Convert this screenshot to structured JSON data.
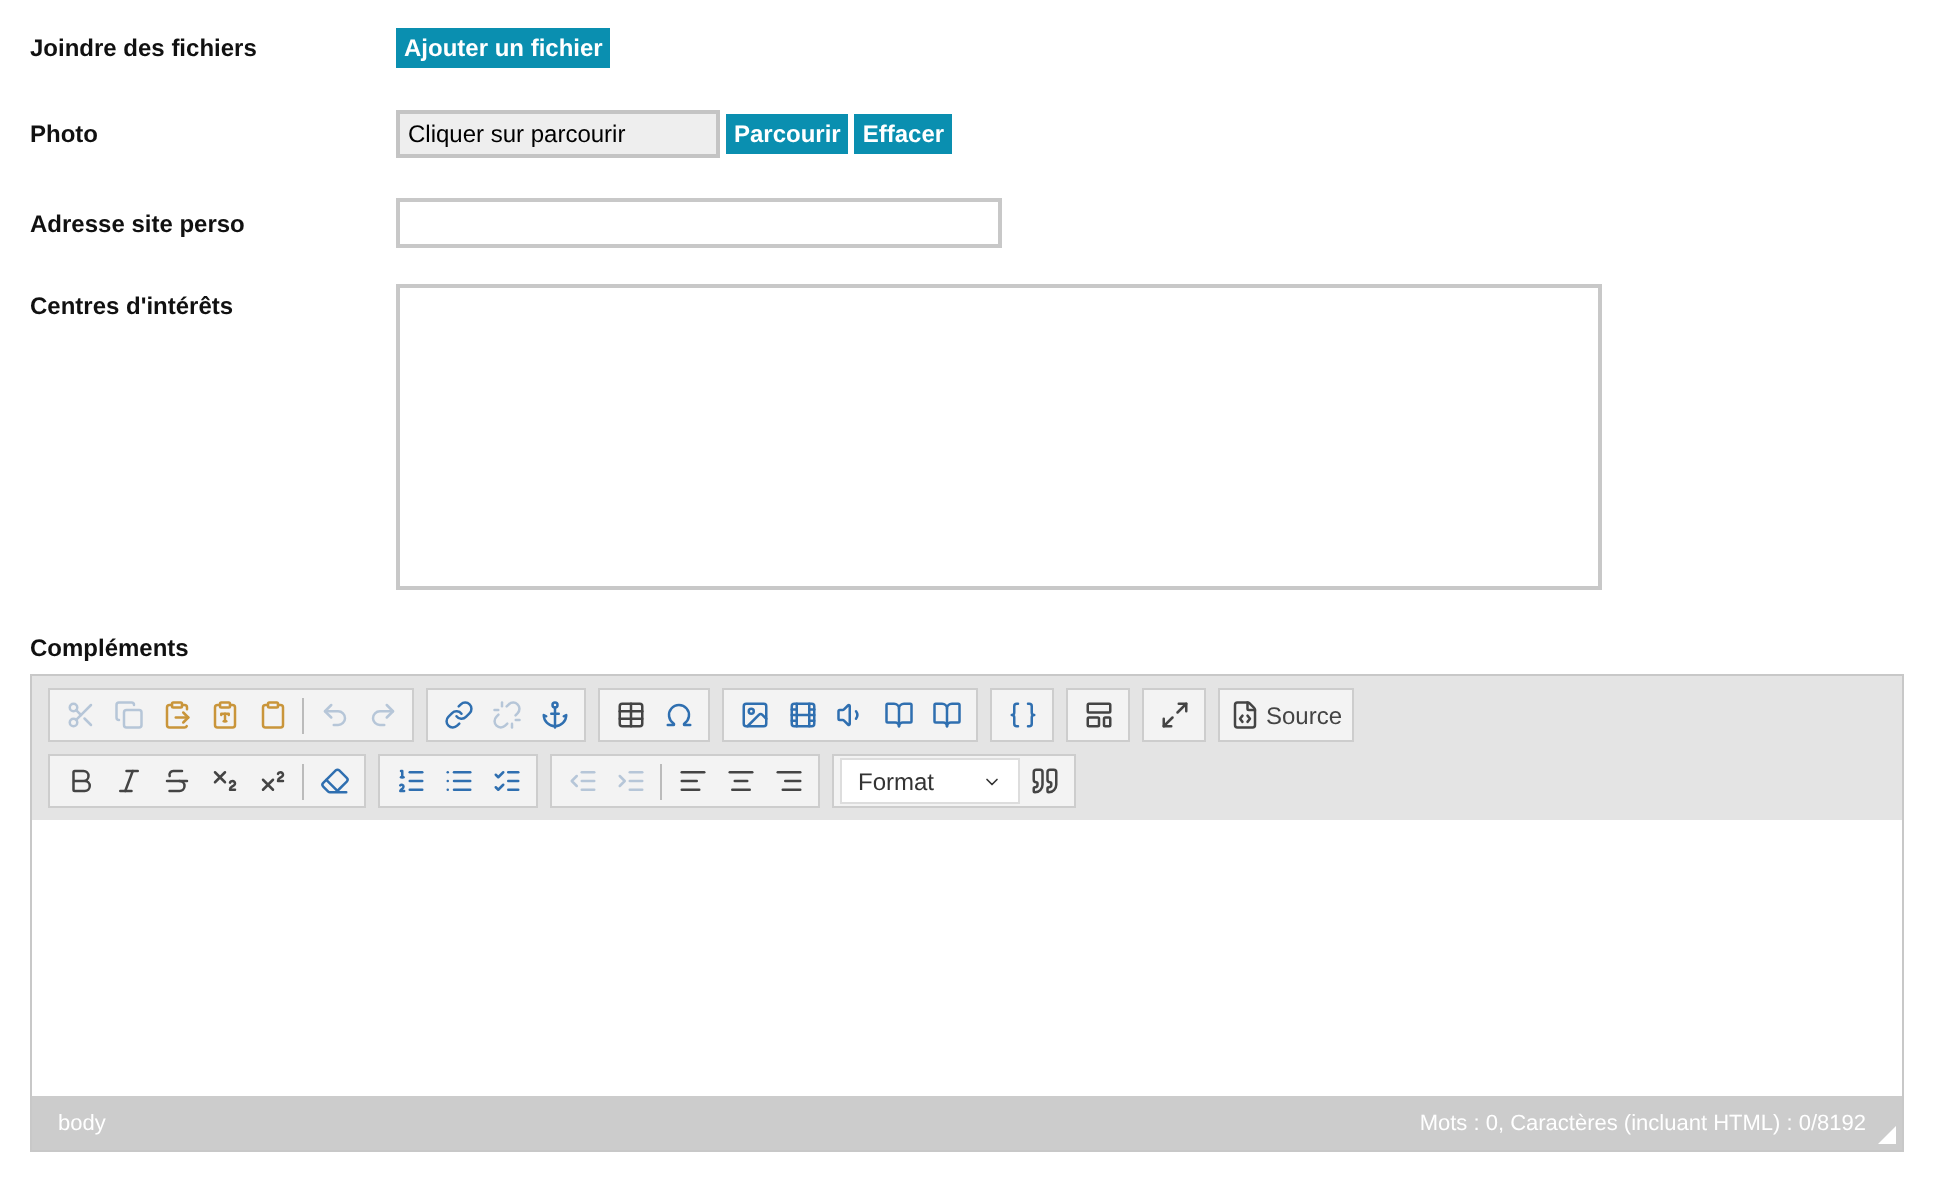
{
  "fields": [
    {
      "kind": "upload",
      "label": "Joindre des fichiers",
      "button": "Ajouter un fichier"
    },
    {
      "kind": "photo",
      "label": "Photo",
      "value": "Cliquer sur parcourir",
      "buttons": [
        "Parcourir",
        "Effacer"
      ]
    },
    {
      "kind": "text",
      "label": "Adresse site perso"
    },
    {
      "kind": "textarea",
      "label": "Centres d'intérêts"
    }
  ],
  "editor": {
    "label": "Compléments",
    "toolbar": [
      [
        [
          {
            "kind": "cut",
            "disabled": true
          },
          {
            "kind": "copy",
            "disabled": true
          },
          {
            "kind": "paste",
            "disabled": false
          },
          {
            "kind": "paste-text",
            "disabled": false
          },
          {
            "kind": "paste-word",
            "disabled": false
          },
          {
            "kind": "sep"
          },
          {
            "kind": "undo",
            "disabled": true
          },
          {
            "kind": "redo",
            "disabled": true
          }
        ],
        [
          {
            "kind": "link",
            "disabled": false
          },
          {
            "kind": "unlink",
            "disabled": true
          },
          {
            "kind": "anchor",
            "disabled": false
          }
        ],
        [
          {
            "kind": "table",
            "disabled": false
          },
          {
            "kind": "omega",
            "disabled": false
          }
        ],
        [
          {
            "kind": "image",
            "disabled": false
          },
          {
            "kind": "film",
            "disabled": false
          },
          {
            "kind": "audio",
            "disabled": false
          },
          {
            "kind": "book",
            "disabled": false
          },
          {
            "kind": "book",
            "disabled": false
          }
        ],
        [
          {
            "kind": "placeholder",
            "disabled": false
          }
        ],
        [
          {
            "kind": "blocks",
            "disabled": false
          }
        ],
        [
          {
            "kind": "maximize",
            "disabled": false
          }
        ],
        [
          {
            "kind": "source",
            "disabled": false,
            "label": "Source"
          }
        ]
      ],
      [
        [
          {
            "kind": "bold",
            "disabled": false
          },
          {
            "kind": "italic",
            "disabled": false
          },
          {
            "kind": "strike",
            "disabled": false
          },
          {
            "kind": "sub",
            "disabled": false
          },
          {
            "kind": "sup",
            "disabled": false
          },
          {
            "kind": "sep"
          },
          {
            "kind": "eraser",
            "disabled": false
          }
        ],
        [
          {
            "kind": "ol",
            "disabled": false
          },
          {
            "kind": "ul",
            "disabled": false
          },
          {
            "kind": "checklist",
            "disabled": false
          }
        ],
        [
          {
            "kind": "outdent",
            "disabled": true
          },
          {
            "kind": "indent",
            "disabled": true
          },
          {
            "kind": "sep"
          },
          {
            "kind": "align-left",
            "disabled": false
          },
          {
            "kind": "align-center",
            "disabled": false
          },
          {
            "kind": "align-right",
            "disabled": false
          }
        ],
        [
          {
            "kind": "combo",
            "label": "Format"
          },
          {
            "kind": "quote",
            "disabled": false
          }
        ]
      ]
    ],
    "path": "body",
    "counter": "Mots : 0, Caractères (incluant HTML) : 0/8192"
  }
}
